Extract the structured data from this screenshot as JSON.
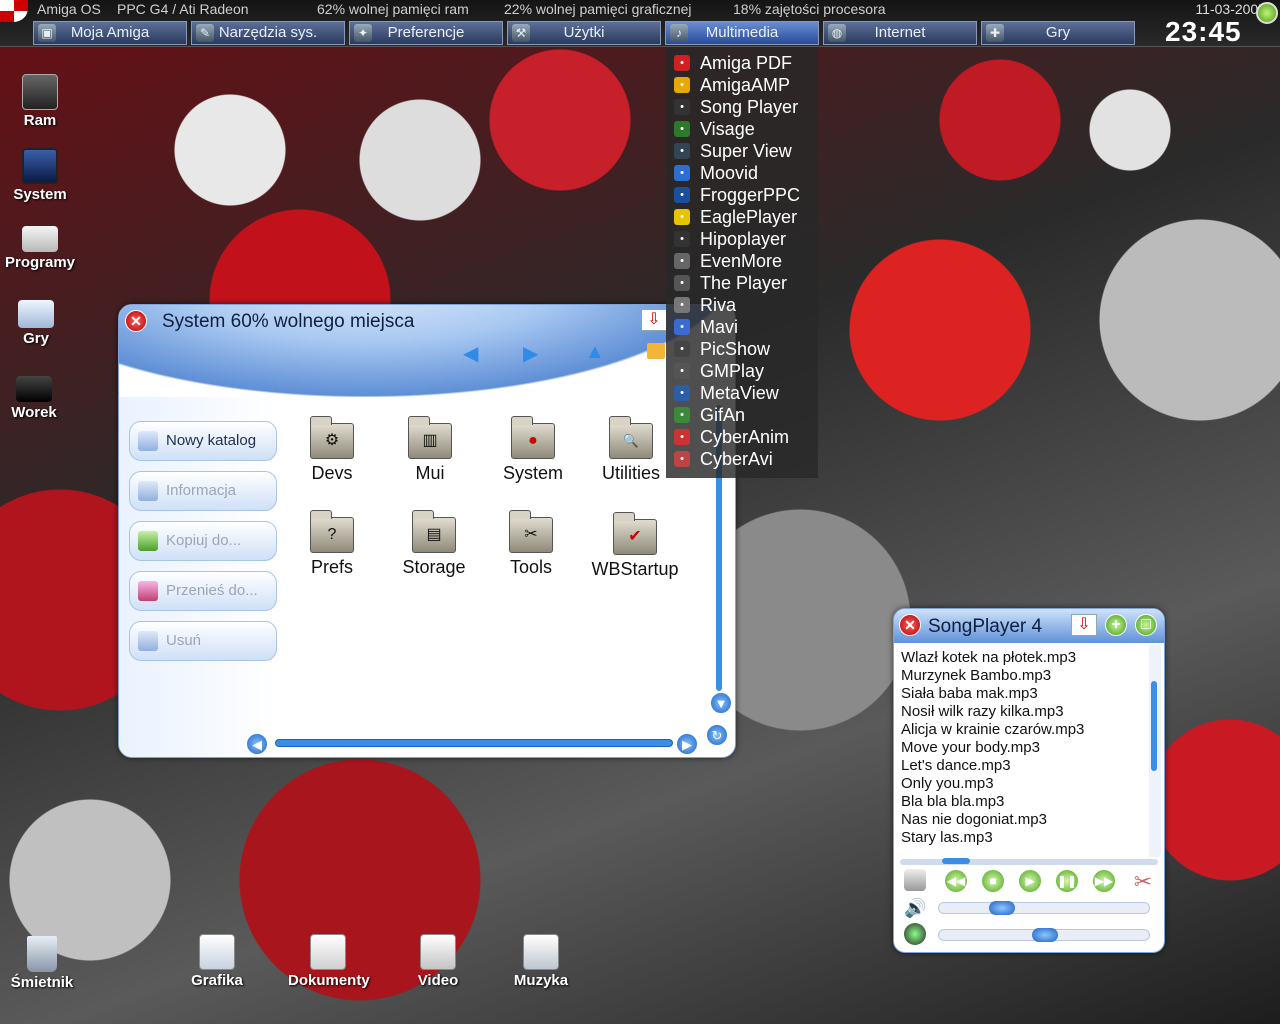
{
  "topbar": {
    "stats": [
      "Amiga OS",
      "PPC G4 / Ati Radeon",
      "62% wolnej pamięci ram",
      "22% wolnej pamięci graficznej",
      "18% zajętości procesora"
    ],
    "menus": [
      {
        "label": "Moja Amiga",
        "icon": "computer-icon"
      },
      {
        "label": "Narzędzia sys.",
        "icon": "tools-icon"
      },
      {
        "label": "Preferencje",
        "icon": "prefs-icon"
      },
      {
        "label": "Użytki",
        "icon": "utilities-icon"
      },
      {
        "label": "Multimedia",
        "icon": "multimedia-icon"
      },
      {
        "label": "Internet",
        "icon": "globe-icon"
      },
      {
        "label": "Gry",
        "icon": "joystick-icon"
      }
    ],
    "date": "11-03-2007",
    "clock": "23:45"
  },
  "desktop_icons": [
    {
      "label": "Ram",
      "icon": "ram-disk-icon"
    },
    {
      "label": "System",
      "icon": "monitor-icon"
    },
    {
      "label": "Programy",
      "icon": "drive-icon"
    },
    {
      "label": "Gry",
      "icon": "games-drive-icon"
    },
    {
      "label": "Worek",
      "icon": "drive-dark-icon"
    },
    {
      "label": "Śmietnik",
      "icon": "trash-icon"
    },
    {
      "label": "Grafika",
      "icon": "graphics-docs-icon"
    },
    {
      "label": "Dokumenty",
      "icon": "documents-icon"
    },
    {
      "label": "Video",
      "icon": "video-docs-icon"
    },
    {
      "label": "Muzyka",
      "icon": "music-docs-icon"
    }
  ],
  "multimedia_menu": [
    "Amiga PDF",
    "AmigaAMP",
    "Song Player",
    "Visage",
    "Super View",
    "Moovid",
    "FroggerPPC",
    "EaglePlayer",
    "Hipoplayer",
    "EvenMore",
    "The Player",
    "Riva",
    "Mavi",
    "PicShow",
    "GMPlay",
    "MetaView",
    "GifAn",
    "CyberAnim",
    "CyberAvi"
  ],
  "system_window": {
    "title": "System 60% wolnego miejsca",
    "sidebar": [
      "Nowy katalog",
      "Informacja",
      "Kopiuj do...",
      "Przenieś do...",
      "Usuń"
    ],
    "folders": [
      {
        "label": "Devs",
        "glyph": "⚙"
      },
      {
        "label": "Mui",
        "glyph": "▥"
      },
      {
        "label": "System",
        "glyph": "●"
      },
      {
        "label": "Utilities",
        "glyph": "🔍"
      },
      {
        "label": "Prefs",
        "glyph": "?"
      },
      {
        "label": "Storage",
        "glyph": "▤"
      },
      {
        "label": "Tools",
        "glyph": "✂"
      },
      {
        "label": "WBStartup",
        "glyph": "✔"
      }
    ]
  },
  "songplayer": {
    "title": "SongPlayer 4",
    "playlist": [
      "Wlazł kotek na płotek.mp3",
      "Murzynek Bambo.mp3",
      "Siała baba mak.mp3",
      "Nosił wilk razy kilka.mp3",
      "Alicja w krainie czarów.mp3",
      "Move your body.mp3",
      "Let's dance.mp3",
      "Only you.mp3",
      "Bla bla bla.mp3",
      "Nas nie dogoniat.mp3",
      "Stary las.mp3"
    ],
    "volume_level": 0.27,
    "balance_level": 0.5
  }
}
